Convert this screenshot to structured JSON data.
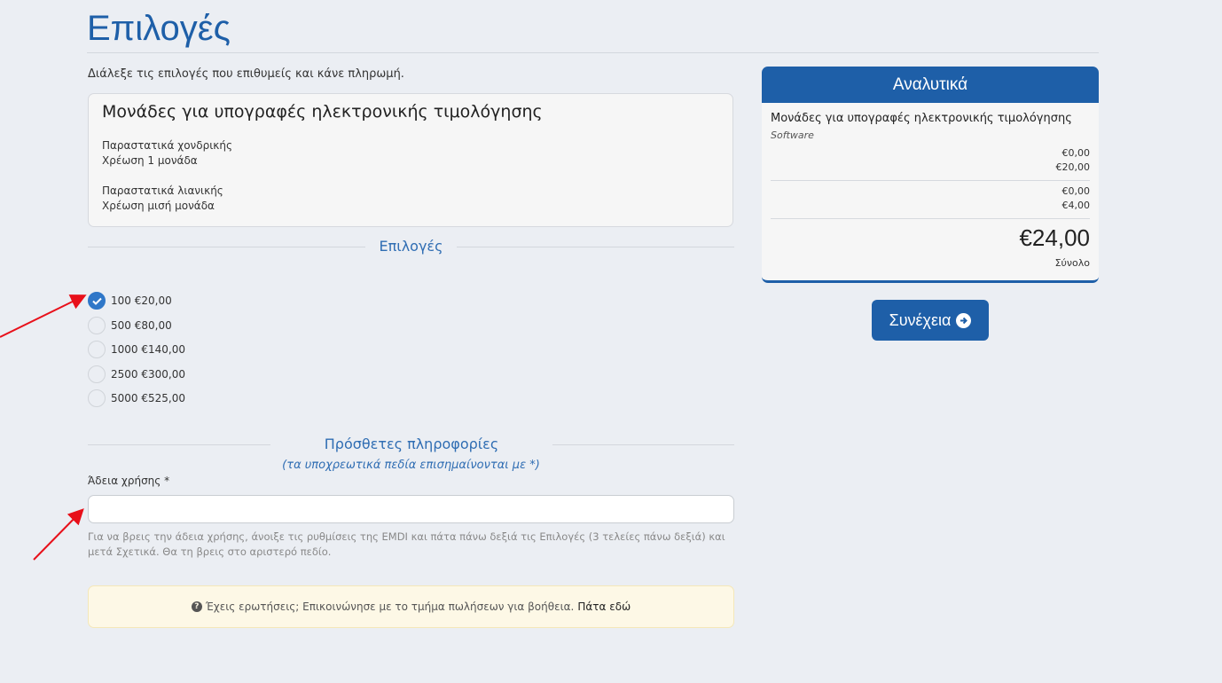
{
  "page": {
    "title": "Επιλογές",
    "intro": "Διάλεξε τις επιλογές που επιθυμείς και κάνε πληρωμή."
  },
  "product": {
    "name": "Μονάδες για υπογραφές ηλεκτρονικής τιμολόγησης",
    "lines": [
      "Παραστατικά χονδρικής",
      "Χρέωση 1 μονάδα",
      "Παραστατικά λιανικής",
      "Χρέωση μισή μονάδα"
    ]
  },
  "options_section": {
    "title": "Επιλογές",
    "selected_index": 0,
    "items": [
      {
        "label": "100 €20,00"
      },
      {
        "label": "500 €80,00"
      },
      {
        "label": "1000 €140,00"
      },
      {
        "label": "2500 €300,00"
      },
      {
        "label": "5000 €525,00"
      }
    ]
  },
  "additional_info": {
    "title": "Πρόσθετες πληροφορίες",
    "subtitle": "(τα υποχρεωτικά πεδία επισημαίνονται με *)",
    "license_label": "Άδεια χρήσης *",
    "license_value": "",
    "help": "Για να βρεις την άδεια χρήσης, άνοιξε τις ρυθμίσεις της EMDI και πάτα πάνω δεξιά τις Επιλογές (3 τελείες πάνω δεξιά) και μετά Σχετικά. Θα τη βρεις στο αριστερό πεδίο."
  },
  "alert": {
    "icon": "question-circle-icon",
    "text": "Έχεις ερωτήσεις; Επικοινώνησε με το τμήμα πωλήσεων για βοήθεια.",
    "link": "Πάτα εδώ"
  },
  "summary": {
    "title": "Αναλυτικά",
    "product": "Μονάδες για υπογραφές ηλεκτρονικής τιμολόγησης",
    "category": "Software",
    "prices_1": [
      "€0,00",
      "€20,00"
    ],
    "prices_2": [
      "€0,00",
      "€4,00"
    ],
    "total": "€24,00",
    "total_label": "Σύνολο"
  },
  "continue_button": {
    "label": "Συνέχεια",
    "icon": "arrow-circle-right-icon"
  },
  "colors": {
    "primary": "#1e5fa8",
    "selected_radio": "#2f77c8",
    "alert_bg": "#fdf8e6",
    "background": "#ebeef3",
    "annotation_arrow": "#e8101a"
  }
}
